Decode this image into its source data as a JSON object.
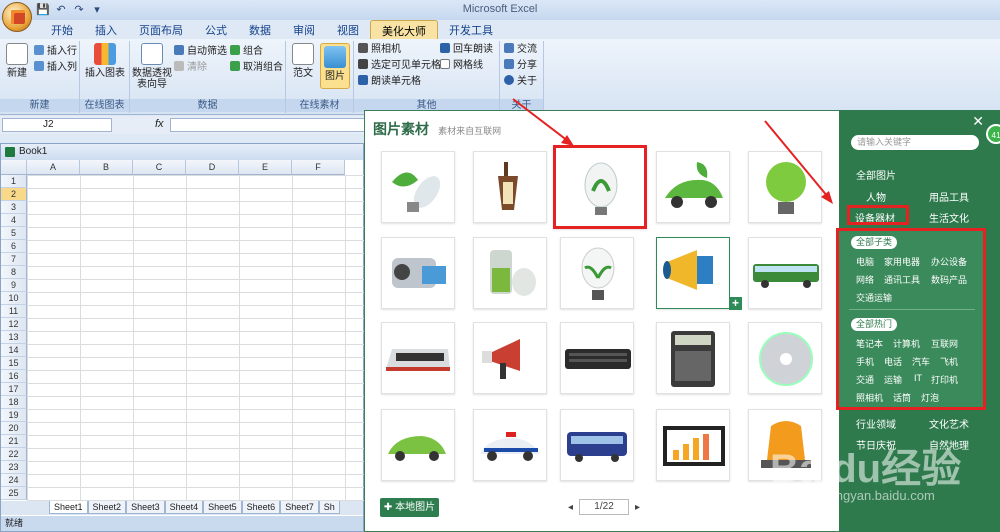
{
  "window": {
    "title": "Microsoft Excel"
  },
  "ribbon_tabs": [
    "开始",
    "插入",
    "页面布局",
    "公式",
    "数据",
    "审阅",
    "视图",
    "美化大师",
    "开发工具"
  ],
  "active_tab_index": 7,
  "ribbon": {
    "new_label": "新建",
    "insert_row": "插入行",
    "insert_col": "插入列",
    "group_new": "新建",
    "insert_chart": "插入图表",
    "group_chart": "在线图表",
    "pivot_wizard": "数据透视表向导",
    "auto_filter": "自动筛选",
    "clear": "清除",
    "group_btn": "组合",
    "ungroup": "取消组合",
    "group_data": "数据",
    "template": "范文",
    "picture": "图片",
    "group_online": "在线素材",
    "camera": "照相机",
    "select_visible": "选定可见单元格",
    "read_cells": "朗读单元格",
    "enter_read": "回车朗读",
    "gridlines": "网格线",
    "group_other": "其他",
    "exchange": "交流",
    "share": "分享",
    "about": "关于",
    "group_about": "关于"
  },
  "formula_bar": {
    "name_box": "J2",
    "fx": "fx",
    "formula": ""
  },
  "workbook": {
    "title": "Book1",
    "columns": [
      "A",
      "B",
      "C",
      "D",
      "E",
      "F"
    ],
    "rows": [
      "1",
      "2",
      "3",
      "4",
      "5",
      "6",
      "7",
      "8",
      "9",
      "10",
      "11",
      "12",
      "13",
      "14",
      "15",
      "16",
      "17",
      "18",
      "19",
      "20",
      "21",
      "22",
      "23",
      "24",
      "25"
    ],
    "selected_row": "2",
    "sheets": [
      "Sheet1",
      "Sheet2",
      "Sheet3",
      "Sheet4",
      "Sheet5",
      "Sheet6",
      "Sheet7",
      "Sh"
    ],
    "status": "就绪"
  },
  "panel": {
    "title": "图片素材",
    "subtitle": "素材来自互联网",
    "images": [
      "leaf-bulb-icon",
      "lantern-icon",
      "plant-bulb-icon",
      "green-car-icon",
      "green-bulb-icon",
      "camcorder-icon",
      "battery-icon",
      "sprout-bulb-icon",
      "megaphone-icon",
      "bus-icon",
      "tram-icon",
      "loudspeaker-icon",
      "keyboard-icon",
      "calculator-icon",
      "cd-icon",
      "electric-car-icon",
      "police-car-icon",
      "coach-bus-icon",
      "chart-monitor-icon",
      "siren-icon"
    ],
    "local_button": "本地图片",
    "page": "1/22"
  },
  "sidebar": {
    "search_placeholder": "请输入关键字",
    "all_pictures": "全部图片",
    "categories": [
      "人物",
      "用品工具",
      "设备器材",
      "生活文化",
      "行业领域",
      "文化艺术",
      "节日庆祝",
      "自然地理"
    ],
    "all_subcategories": "全部子类",
    "subcategories": [
      "电脑",
      "家用电器",
      "办公设备",
      "网络",
      "通讯工具",
      "数码产品",
      "交通运输"
    ],
    "all_hot": "全部热门",
    "hot": [
      "笔记本",
      "计算机",
      "互联网",
      "手机",
      "电话",
      "汽车",
      "飞机",
      "交通",
      "运输",
      "IT",
      "打印机",
      "照相机",
      "话筒",
      "灯泡"
    ]
  },
  "watermark": {
    "text": "Baidu经验",
    "url": "jingyan.baidu.com"
  },
  "colors": {
    "accent_green": "#2e7a4d",
    "highlight_red": "#e52222",
    "ribbon_blue": "#dfe9f5"
  }
}
